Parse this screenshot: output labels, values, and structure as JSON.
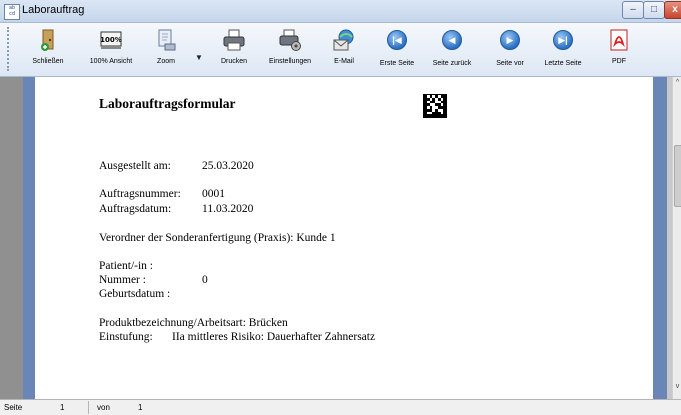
{
  "window": {
    "title": "Laborauftrag",
    "app_icon_text": "ab cd"
  },
  "window_controls": {
    "minimize": "–",
    "maximize": "□",
    "close": "x"
  },
  "toolbar": {
    "buttons": [
      {
        "label": "Schließen",
        "icon": "exit-door-icon"
      },
      {
        "label": "100% Ansicht",
        "icon": "zoom-100-icon"
      },
      {
        "label": "Zoom",
        "icon": "zoom-icon"
      },
      {
        "label": "Drucken",
        "icon": "printer-icon"
      },
      {
        "label": "Einstellungen",
        "icon": "printer-settings-icon"
      },
      {
        "label": "E-Mail",
        "icon": "email-icon"
      },
      {
        "label": "Erste Seite",
        "icon": "first-page-icon"
      },
      {
        "label": "Seite zurück",
        "icon": "previous-page-icon"
      },
      {
        "label": "Seite vor",
        "icon": "next-page-icon"
      },
      {
        "label": "Letzte Seite",
        "icon": "last-page-icon"
      },
      {
        "label": "PDF",
        "icon": "pdf-icon"
      }
    ],
    "zoom_icon_text": "100%"
  },
  "document": {
    "title": "Laborauftragsformular",
    "issued_label": "Ausgestellt am:",
    "issued_value": "25.03.2020",
    "order_number_label": "Auftragsnummer:",
    "order_number_value": "0001",
    "order_date_label": "Auftragsdatum:",
    "order_date_value": "11.03.2020",
    "prescriber_line": "Verordner der Sonderanfertigung (Praxis): Kunde 1",
    "patient_label": "Patient/-in :",
    "number_label": "Nummer :",
    "number_value": "0",
    "birthdate_label": "Geburtsdatum :",
    "product_line": "Produktbezeichnung/Arbeitsart: Brücken",
    "classification_label": "Einstufung:",
    "classification_value": "IIa mittleres Risiko: Dauerhafter Zahnersatz"
  },
  "statusbar": {
    "page_label": "Seite",
    "page_value": "1",
    "of_label": "von",
    "total_value": "1"
  },
  "colors": {
    "page_frame": "#6a86b6",
    "doc_background": "#909090",
    "title_bar": "#c5d6ec"
  }
}
